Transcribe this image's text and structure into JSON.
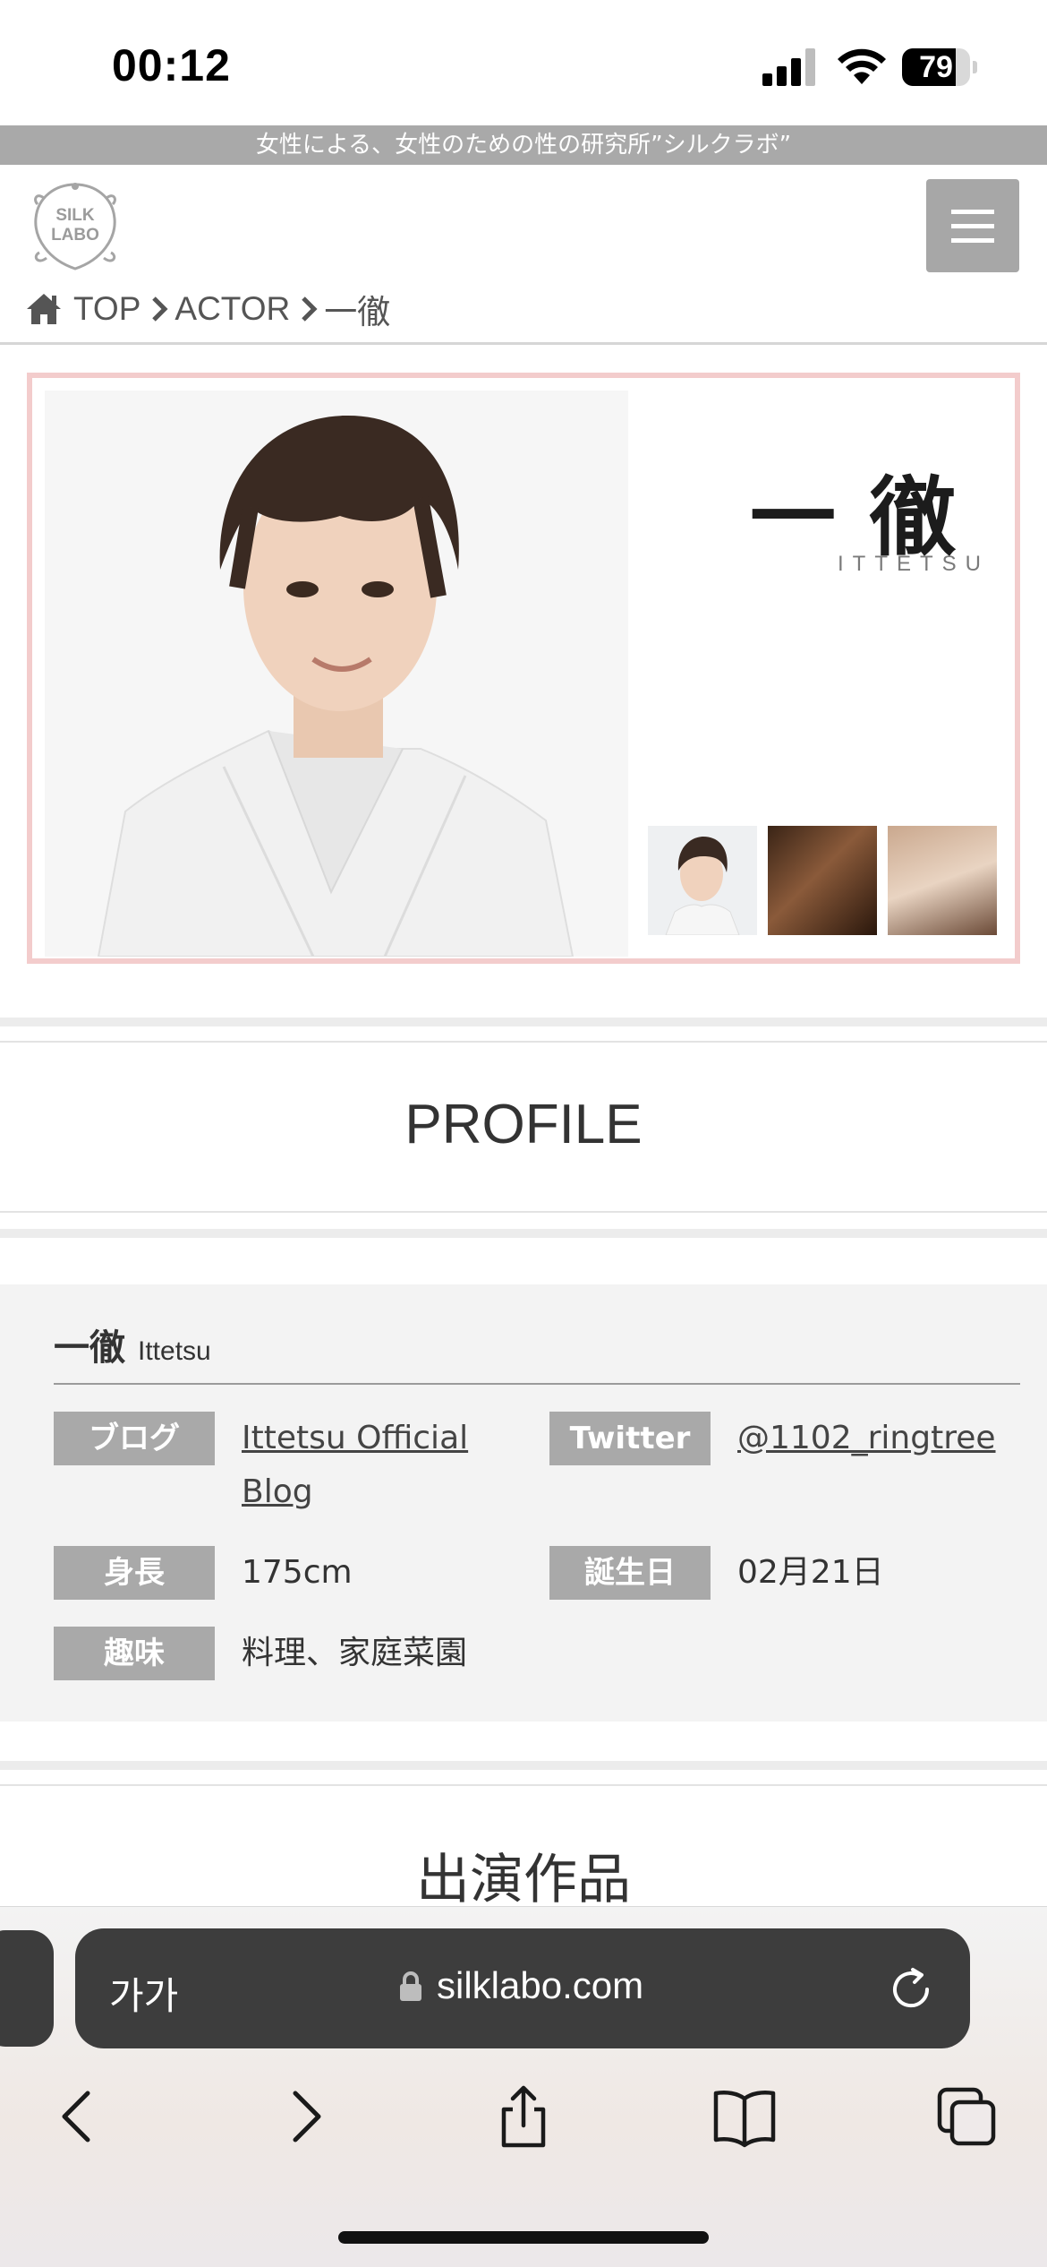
{
  "status_bar": {
    "time": "00:12",
    "battery_percent": "79",
    "battery_level": 0.79,
    "icons": [
      "signal-icon",
      "wifi-icon",
      "battery-icon"
    ]
  },
  "site": {
    "tagline": "女性による、女性のための性の研究所”シルクラボ”",
    "logo_text_line1": "SILK",
    "logo_text_line2": "LABO",
    "menu_icon": "hamburger-menu-icon"
  },
  "breadcrumb": {
    "items": [
      "TOP",
      "ACTOR",
      "一徹"
    ],
    "home_icon": "home-icon",
    "separator_icon": "chevron-right-icon"
  },
  "hero": {
    "name": "一徹",
    "romaji": "ITTETSU",
    "border_color": "#f3cccc"
  },
  "profile": {
    "heading": "PROFILE",
    "name_jp": "一徹",
    "name_en": "Ittetsu",
    "fields": {
      "blog_label": "ブログ",
      "blog_value": "Ittetsu Official Blog",
      "twitter_label": "Twitter",
      "twitter_value": "@1102_ringtree",
      "height_label": "身長",
      "height_value": "175cm",
      "birthday_label": "誕生日",
      "birthday_value": "02月21日",
      "hobby_label": "趣味",
      "hobby_value": "料理、家庭菜園"
    }
  },
  "works": {
    "heading": "出演作品"
  },
  "browser": {
    "text_size_label": "가가",
    "url": "silklabo.com",
    "icons": [
      "lock-icon",
      "reload-icon",
      "back-icon",
      "forward-icon",
      "share-icon",
      "bookmarks-icon",
      "tabs-icon"
    ]
  }
}
